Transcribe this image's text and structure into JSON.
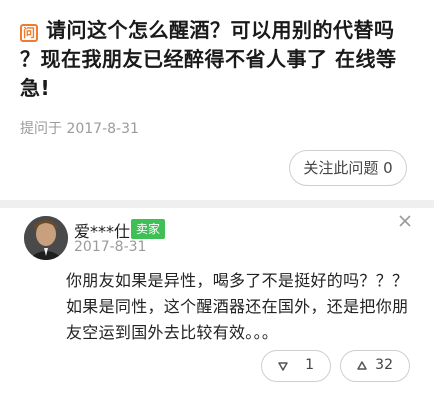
{
  "question": {
    "badge": "问",
    "title": "请问这个怎么醒酒？可以用别的代替吗 ？现在我朋友已经醉得不省人事了 在线等 急!",
    "meta": "提问于 2017-8-31",
    "follow_label": "关注此问题 0"
  },
  "answer": {
    "username": "爱***仕",
    "seller_tag": "卖家",
    "date": "2017-8-31",
    "text": "你朋友如果是异性，喝多了不是挺好的吗？？？如果是同性，这个醒酒器还在国外，还是把你朋友空运到国外去比较有效。。。",
    "downvote_count": "1",
    "upvote_count": "32"
  },
  "colors": {
    "accent_orange": "#f07b2e",
    "seller_green": "#3fbf55"
  }
}
